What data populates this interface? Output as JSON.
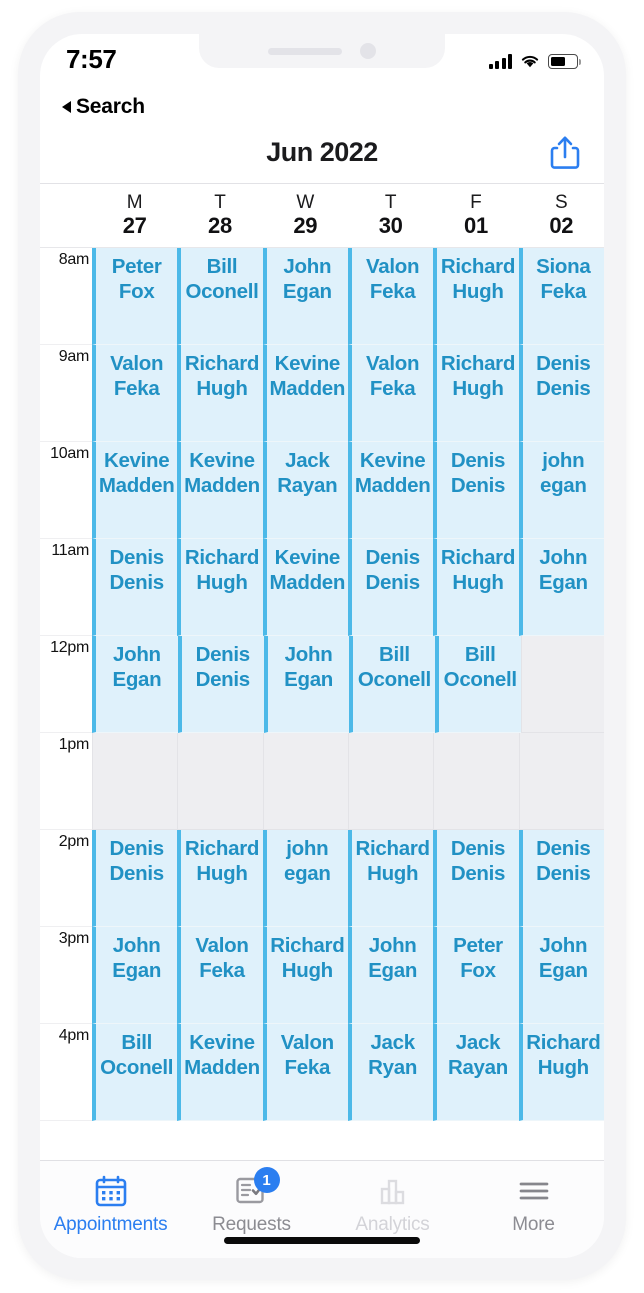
{
  "status_bar": {
    "time": "7:57",
    "cellular_icon": "signal-bars-icon",
    "wifi_icon": "wifi-icon",
    "battery_icon": "battery-icon"
  },
  "back": {
    "label": "Search",
    "icon": "back-triangle-icon"
  },
  "header": {
    "title": "Jun 2022",
    "share_icon": "share-icon"
  },
  "days": [
    {
      "dow": "M",
      "num": "27"
    },
    {
      "dow": "T",
      "num": "28"
    },
    {
      "dow": "W",
      "num": "29"
    },
    {
      "dow": "T",
      "num": "30"
    },
    {
      "dow": "F",
      "num": "01"
    },
    {
      "dow": "S",
      "num": "02"
    }
  ],
  "time_slots": [
    "8am",
    "9am",
    "10am",
    "11am",
    "12pm",
    "1pm",
    "2pm",
    "3pm",
    "4pm"
  ],
  "appointments": [
    {
      "time": "8am",
      "cells": [
        {
          "first": "Peter",
          "last": "Fox"
        },
        {
          "first": "Bill",
          "last": "Oconell"
        },
        {
          "first": "John",
          "last": "Egan"
        },
        {
          "first": "Valon",
          "last": "Feka"
        },
        {
          "first": "Richard",
          "last": "Hugh"
        },
        {
          "first": "Siona",
          "last": "Feka"
        }
      ]
    },
    {
      "time": "9am",
      "cells": [
        {
          "first": "Valon",
          "last": "Feka"
        },
        {
          "first": "Richard",
          "last": "Hugh"
        },
        {
          "first": "Kevine",
          "last": "Madden"
        },
        {
          "first": "Valon",
          "last": "Feka"
        },
        {
          "first": "Richard",
          "last": "Hugh"
        },
        {
          "first": "Denis",
          "last": "Denis"
        }
      ]
    },
    {
      "time": "10am",
      "cells": [
        {
          "first": "Kevine",
          "last": "Madden"
        },
        {
          "first": "Kevine",
          "last": "Madden"
        },
        {
          "first": "Jack",
          "last": "Rayan"
        },
        {
          "first": "Kevine",
          "last": "Madden"
        },
        {
          "first": "Denis",
          "last": "Denis"
        },
        {
          "first": "john",
          "last": "egan"
        }
      ]
    },
    {
      "time": "11am",
      "cells": [
        {
          "first": "Denis",
          "last": "Denis"
        },
        {
          "first": "Richard",
          "last": "Hugh"
        },
        {
          "first": "Kevine",
          "last": "Madden"
        },
        {
          "first": "Denis",
          "last": "Denis"
        },
        {
          "first": "Richard",
          "last": "Hugh"
        },
        {
          "first": "John",
          "last": "Egan"
        }
      ]
    },
    {
      "time": "12pm",
      "cells": [
        {
          "first": "John",
          "last": "Egan"
        },
        {
          "first": "Denis",
          "last": "Denis"
        },
        {
          "first": "John",
          "last": "Egan"
        },
        {
          "first": "Bill",
          "last": "Oconell"
        },
        {
          "first": "Bill",
          "last": "Oconell"
        },
        null
      ]
    },
    {
      "time": "1pm",
      "cells": [
        null,
        null,
        null,
        null,
        null,
        null
      ]
    },
    {
      "time": "2pm",
      "cells": [
        {
          "first": "Denis",
          "last": "Denis"
        },
        {
          "first": "Richard",
          "last": "Hugh"
        },
        {
          "first": "john",
          "last": "egan"
        },
        {
          "first": "Richard",
          "last": "Hugh"
        },
        {
          "first": "Denis",
          "last": "Denis"
        },
        {
          "first": "Denis",
          "last": "Denis"
        }
      ]
    },
    {
      "time": "3pm",
      "cells": [
        {
          "first": "John",
          "last": "Egan"
        },
        {
          "first": "Valon",
          "last": "Feka"
        },
        {
          "first": "Richard",
          "last": "Hugh"
        },
        {
          "first": "John",
          "last": "Egan"
        },
        {
          "first": "Peter",
          "last": "Fox"
        },
        {
          "first": "John",
          "last": "Egan"
        }
      ]
    },
    {
      "time": "4pm",
      "cells": [
        {
          "first": "Bill",
          "last": "Oconell"
        },
        {
          "first": "Kevine",
          "last": "Madden"
        },
        {
          "first": "Valon",
          "last": "Feka"
        },
        {
          "first": "Jack",
          "last": "Ryan"
        },
        {
          "first": "Jack",
          "last": "Rayan"
        },
        {
          "first": "Richard",
          "last": "Hugh"
        }
      ]
    }
  ],
  "tabs": [
    {
      "label": "Appointments",
      "icon": "calendar-icon",
      "state": "active",
      "badge": null
    },
    {
      "label": "Requests",
      "icon": "checklist-icon",
      "state": "normal",
      "badge": "1"
    },
    {
      "label": "Analytics",
      "icon": "bar-chart-icon",
      "state": "dim",
      "badge": null
    },
    {
      "label": "More",
      "icon": "hamburger-icon",
      "state": "normal",
      "badge": null
    }
  ],
  "colors": {
    "accent_blue": "#2b7ef0",
    "appointment_text": "#2191c4",
    "appointment_fill": "#dff1fb",
    "appointment_border": "#4cb9e8",
    "empty_cell": "#eeeef1"
  }
}
